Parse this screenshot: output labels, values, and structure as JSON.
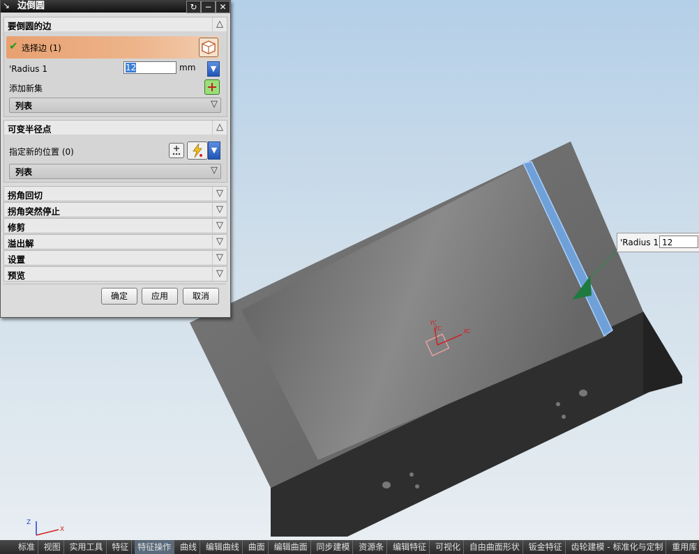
{
  "dialog": {
    "title": "边倒圆",
    "sections": {
      "edges": {
        "header": "要倒圆的边",
        "select_label": "选择边 (1)",
        "radius_label": "'Radius 1",
        "radius_value": "12",
        "radius_unit": "mm",
        "add_set_label": "添加新集",
        "list_label": "列表"
      },
      "variable": {
        "header": "可变半径点",
        "new_location_label": "指定新的位置 (0)",
        "list_label": "列表"
      },
      "collapsed": [
        "拐角回切",
        "拐角突然停止",
        "修剪",
        "溢出解",
        "设置",
        "预览"
      ]
    },
    "buttons": {
      "ok": "确定",
      "apply": "应用",
      "cancel": "取消"
    }
  },
  "float_input": {
    "label": "'Radius 1",
    "value": "12"
  },
  "axis_labels": {
    "z": "Z",
    "x": "X",
    "xc": "XC",
    "yc": "YC",
    "zc": "ZC"
  },
  "tabs": [
    "标准",
    "视图",
    "实用工具",
    "特征",
    "特征操作",
    "曲线",
    "编辑曲线",
    "曲面",
    "编辑曲面",
    "同步建模",
    "资源条",
    "编辑特征",
    "可视化",
    "自由曲面形状",
    "钣金特征",
    "齿轮建模 - 标准化与定制",
    "重用库"
  ],
  "active_tab": "特征操作",
  "colors": {
    "accent_orange": "#e8a070",
    "selected_edge": "#6fa0d8",
    "model_top": "#6e6e6e",
    "model_side": "#2f2f2f"
  }
}
